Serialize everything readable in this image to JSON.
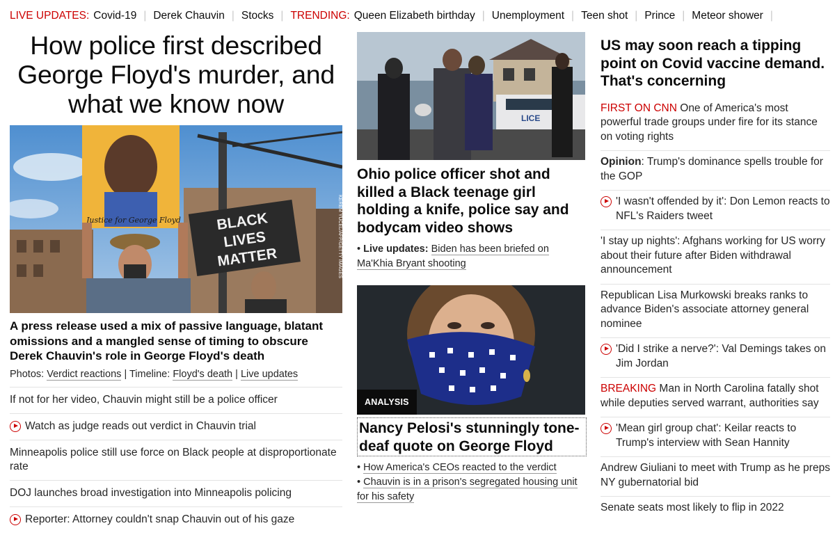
{
  "nav": {
    "live_label": "LIVE UPDATES:",
    "live_item": "Covid-19",
    "items_a": [
      "Derek Chauvin",
      "Stocks"
    ],
    "trending_label": "TRENDING:",
    "items_b": [
      "Queen Elizabeth birthday",
      "Unemployment",
      "Teen shot",
      "Prince",
      "Meteor shower"
    ]
  },
  "lead": {
    "title": "How police first described George Floyd's murder, and what we know now",
    "image_credit": "KEREM YUCEL/AFP/GETTY IMAGES",
    "sign_portrait": "Justice for George Floyd",
    "sign_blm": [
      "BLACK",
      "LIVES",
      "MATTER"
    ],
    "subheadline": "A press release used a mix of passive language, blatant omissions and a mangled sense of timing to obscure Derek Chauvin's role in George Floyd's death",
    "photos_label": "Photos:",
    "photos_link": "Verdict reactions",
    "timeline_label": "Timeline:",
    "timeline_link": "Floyd's death",
    "live_link": "Live updates",
    "list": [
      {
        "text": "If not for her video, Chauvin might still be a police officer",
        "video": false
      },
      {
        "text": "Watch as judge reads out verdict in Chauvin trial",
        "video": true
      },
      {
        "text": "Minneapolis police still use force on Black people at disproportionate rate",
        "video": false
      },
      {
        "text": "DOJ launches broad investigation into Minneapolis policing",
        "video": false
      },
      {
        "text": "Reporter: Attorney couldn't snap Chauvin out of his gaze",
        "video": true
      }
    ]
  },
  "middle": {
    "story1": {
      "title": "Ohio police officer shot and killed a Black teenage girl holding a knife, police say and bodycam video shows",
      "live_label": "Live updates:",
      "live_text": "Biden has been briefed on Ma'Khia Bryant shooting"
    },
    "story2": {
      "badge": "ANALYSIS",
      "title": "Nancy Pelosi's stunningly tone-deaf quote on George Floyd",
      "bullets": [
        "How America's CEOs reacted to the verdict",
        "Chauvin is in a prison's segregated housing unit for his safety"
      ]
    }
  },
  "right": {
    "title": "US may soon reach a tipping point on Covid vaccine demand. That's concerning",
    "items": [
      {
        "prefix": "FIRST ON CNN",
        "prefix_style": "red",
        "text": " One of America's most powerful trade groups under fire for its stance on voting rights",
        "video": false
      },
      {
        "prefix": "Opinion",
        "prefix_style": "bold",
        "text": ": Trump's dominance spells trouble for the GOP",
        "video": false
      },
      {
        "prefix": "",
        "prefix_style": "",
        "text": "'I wasn't offended by it': Don Lemon reacts to NFL's Raiders tweet",
        "video": true
      },
      {
        "prefix": "",
        "prefix_style": "",
        "text": "'I stay up nights': Afghans working for US worry about their future after Biden withdrawal announcement",
        "video": false
      },
      {
        "prefix": "",
        "prefix_style": "",
        "text": "Republican Lisa Murkowski breaks ranks to advance Biden's associate attorney general nominee",
        "video": false
      },
      {
        "prefix": "",
        "prefix_style": "",
        "text": "'Did I strike a nerve?': Val Demings takes on Jim Jordan",
        "video": true
      },
      {
        "prefix": "BREAKING",
        "prefix_style": "red",
        "text": " Man in North Carolina fatally shot while deputies served warrant, authorities say",
        "video": false
      },
      {
        "prefix": "",
        "prefix_style": "",
        "text": "'Mean girl group chat': Keilar reacts to Trump's interview with Sean Hannity",
        "video": true
      },
      {
        "prefix": "",
        "prefix_style": "",
        "text": "Andrew Giuliani to meet with Trump as he preps NY gubernatorial bid",
        "video": false
      },
      {
        "prefix": "",
        "prefix_style": "",
        "text": "Senate seats most likely to flip in 2022",
        "video": false
      }
    ]
  },
  "colors": {
    "accent": "#cc0000",
    "text": "#0c0c0c",
    "divider": "#e3e3e3"
  }
}
